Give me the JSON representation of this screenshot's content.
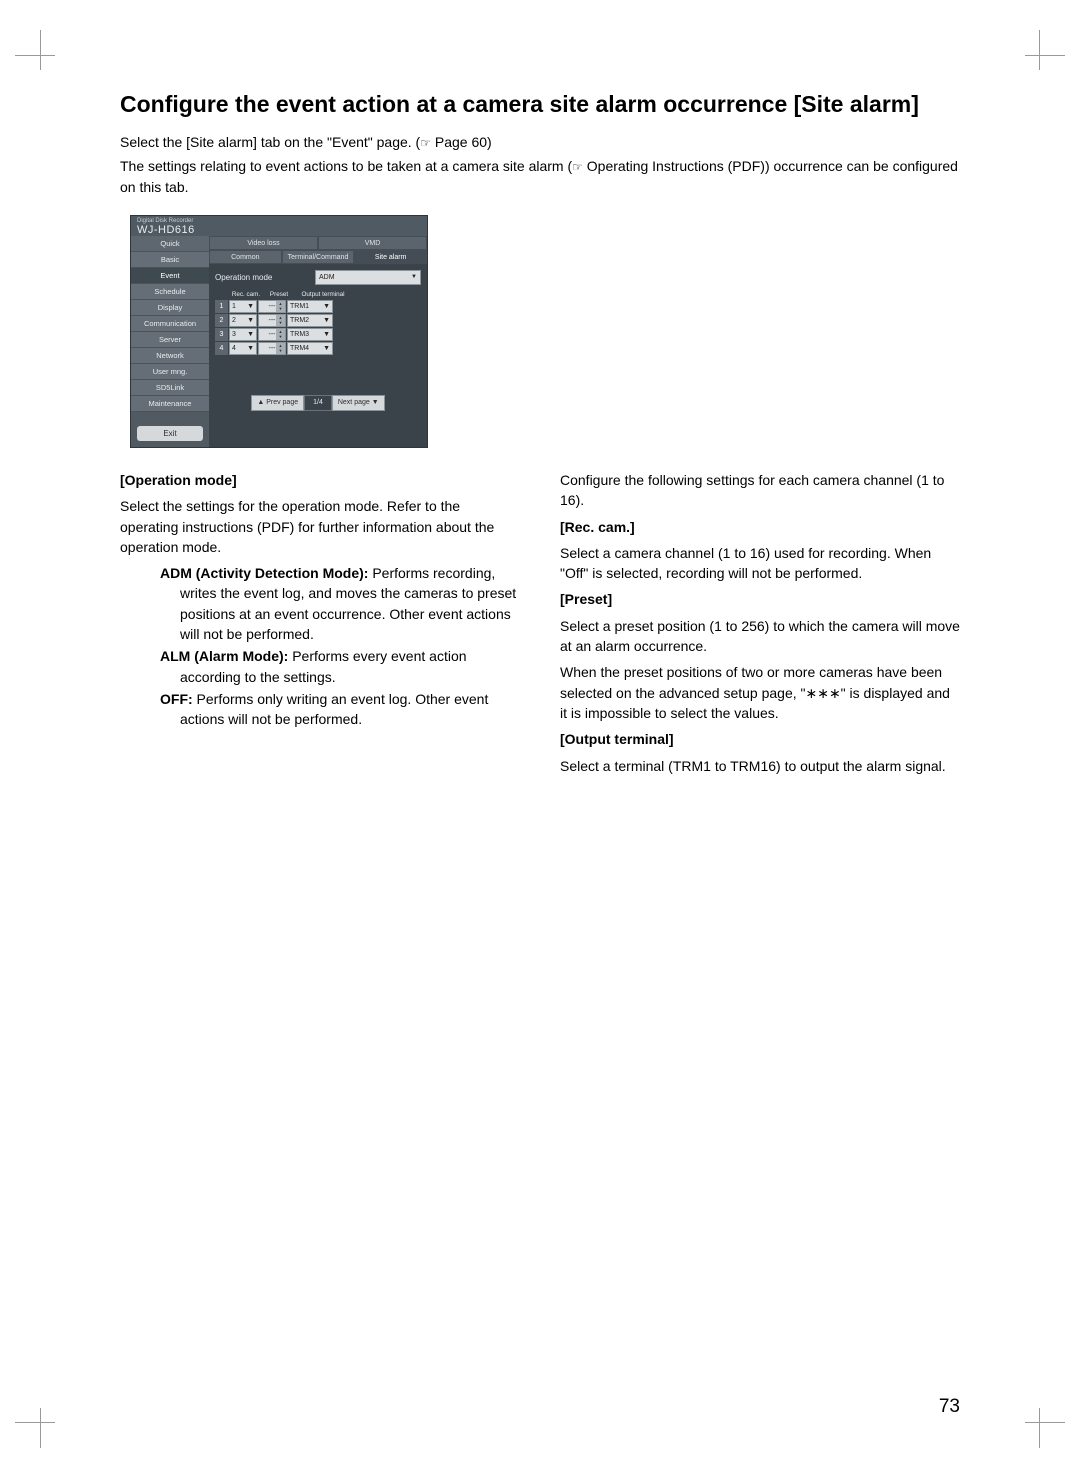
{
  "title": "Configure the event action at a camera site alarm occurrence [Site alarm]",
  "intro_line1_a": "Select the [Site alarm] tab on the \"Event\" page. (",
  "intro_line1_ref": "☞",
  "intro_line1_b": " Page 60)",
  "intro_line2_a": "The settings relating to event actions to be taken at a camera site alarm (",
  "intro_line2_ref": "☞",
  "intro_line2_b": " Operating Instructions (PDF)) occurrence can be configured on this tab.",
  "ui": {
    "brand_small": "Digital Disk Recorder",
    "model": "WJ-HD616",
    "sidebar": [
      "Quick",
      "Basic",
      "Event",
      "Schedule",
      "Display",
      "Communication",
      "Server",
      "Network",
      "User mng.",
      "SD5Link",
      "Maintenance"
    ],
    "sidebar_selected_index": 2,
    "exit": "Exit",
    "tabs_row1": [
      "Video loss",
      "VMD"
    ],
    "tabs_row2": [
      "Common",
      "Terminal/Command",
      "Site alarm"
    ],
    "tabs_row2_active_index": 2,
    "op_mode_label": "Operation mode",
    "op_mode_value": "ADM",
    "table_headers": {
      "rec": "Rec. cam.",
      "preset": "Preset",
      "out": "Output terminal"
    },
    "rows": [
      {
        "n": "1",
        "rec": "1",
        "preset": "---",
        "out": "TRM1"
      },
      {
        "n": "2",
        "rec": "2",
        "preset": "---",
        "out": "TRM2"
      },
      {
        "n": "3",
        "rec": "3",
        "preset": "---",
        "out": "TRM3"
      },
      {
        "n": "4",
        "rec": "4",
        "preset": "---",
        "out": "TRM4"
      }
    ],
    "pager_prev": "▲ Prev page",
    "pager_count": "1/4",
    "pager_next": "Next page ▼"
  },
  "left": {
    "h1": "[Operation mode]",
    "p1": "Select the settings for the operation mode. Refer to the operating instructions (PDF) for further information about the operation mode.",
    "adm_b": "ADM (Activity Detection Mode): ",
    "adm_t": "Performs recording, writes the event log, and moves the cameras to preset positions at an event occurrence. Other event actions will not be performed.",
    "alm_b": "ALM (Alarm Mode): ",
    "alm_t": "Performs every event action according to the settings.",
    "off_b": "OFF: ",
    "off_t": "Performs only writing an event log. Other event actions will not be performed."
  },
  "right": {
    "p0": "Configure the following settings for each camera channel (1 to 16).",
    "h2": "[Rec. cam.]",
    "p2": "Select a camera channel (1 to 16) used for recording. When \"Off\" is selected, recording will not be performed.",
    "h3": "[Preset]",
    "p3a": "Select a preset position (1 to 256) to which the camera will move at an alarm occurrence.",
    "p3b": "When the preset positions of two or more cameras have been selected on the advanced setup page, \"∗∗∗\" is displayed and it is impossible to select the values.",
    "h4": "[Output terminal]",
    "p4": "Select a terminal (TRM1 to TRM16) to output the alarm signal."
  },
  "page_number": "73"
}
